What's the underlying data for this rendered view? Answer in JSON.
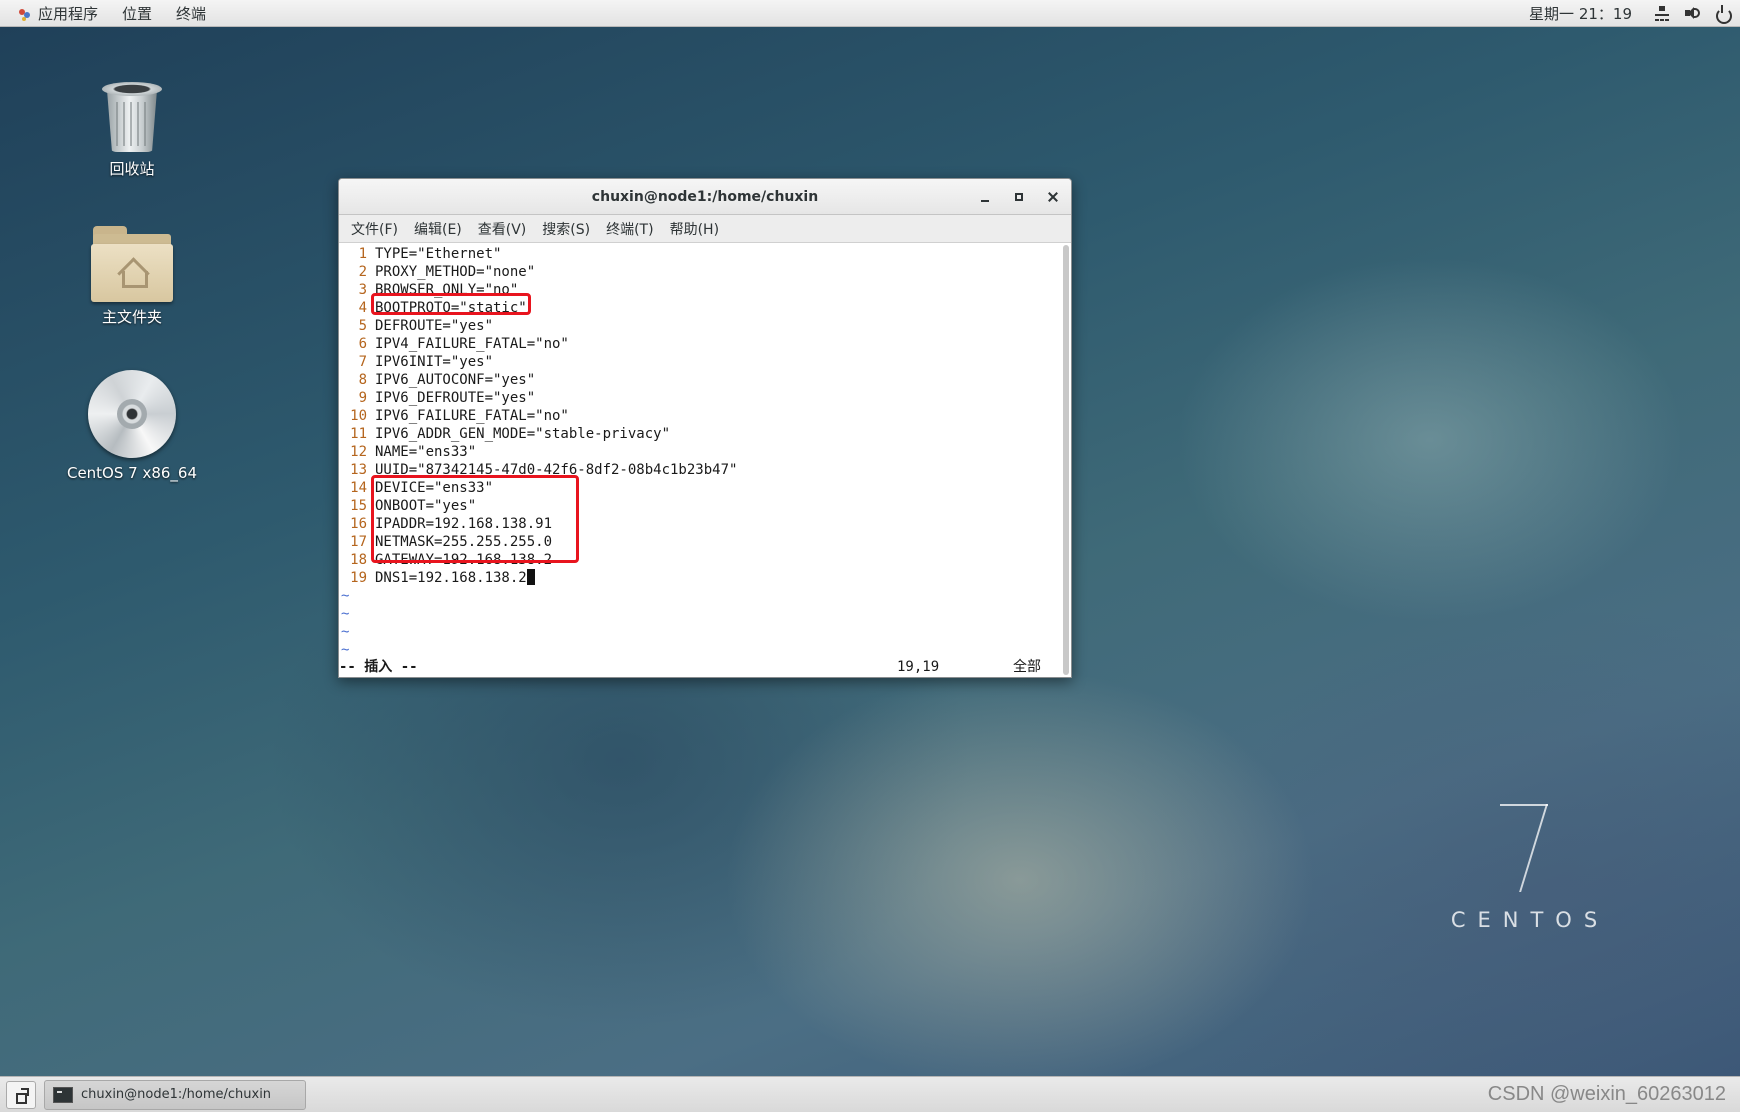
{
  "topbar": {
    "menu_applications": "应用程序",
    "menu_places": "位置",
    "menu_terminal": "终端",
    "clock": "星期一 21：19",
    "icons": [
      "network-icon",
      "volume-icon",
      "power-icon"
    ]
  },
  "desktop_icons": [
    {
      "label": "回收站",
      "icon": "trash-icon"
    },
    {
      "label": "主文件夹",
      "icon": "home-folder-icon"
    },
    {
      "label": "CentOS 7 x86_64",
      "icon": "cd-disc-icon"
    }
  ],
  "window": {
    "title": "chuxin@node1:/home/chuxin",
    "menu": [
      "文件(F)",
      "编辑(E)",
      "查看(V)",
      "搜索(S)",
      "终端(T)",
      "帮助(H)"
    ],
    "lines": [
      {
        "n": "1",
        "text": "TYPE=\"Ethernet\""
      },
      {
        "n": "2",
        "text": "PROXY_METHOD=\"none\""
      },
      {
        "n": "3",
        "text": "BROWSER_ONLY=\"no\""
      },
      {
        "n": "4",
        "text": "BOOTPROTO=\"static\""
      },
      {
        "n": "5",
        "text": "DEFROUTE=\"yes\""
      },
      {
        "n": "6",
        "text": "IPV4_FAILURE_FATAL=\"no\""
      },
      {
        "n": "7",
        "text": "IPV6INIT=\"yes\""
      },
      {
        "n": "8",
        "text": "IPV6_AUTOCONF=\"yes\""
      },
      {
        "n": "9",
        "text": "IPV6_DEFROUTE=\"yes\""
      },
      {
        "n": "10",
        "text": "IPV6_FAILURE_FATAL=\"no\""
      },
      {
        "n": "11",
        "text": "IPV6_ADDR_GEN_MODE=\"stable-privacy\""
      },
      {
        "n": "12",
        "text": "NAME=\"ens33\""
      },
      {
        "n": "13",
        "text": "UUID=\"87342145-47d0-42f6-8df2-08b4c1b23b47\""
      },
      {
        "n": "14",
        "text": "DEVICE=\"ens33\""
      },
      {
        "n": "15",
        "text": "ONBOOT=\"yes\""
      },
      {
        "n": "16",
        "text": "IPADDR=192.168.138.91"
      },
      {
        "n": "17",
        "text": "NETMASK=255.255.255.0"
      },
      {
        "n": "18",
        "text": "GATEWAY=192.168.138.2"
      },
      {
        "n": "19",
        "text": "DNS1=192.168.138.2"
      }
    ],
    "tilde": "~",
    "status_mode": "-- 插入 --",
    "status_position": "19,19",
    "status_scope": "全部"
  },
  "logo": {
    "seven": "7",
    "text": "CENTOS"
  },
  "taskbar": {
    "task_label": "chuxin@node1:/home/chuxin",
    "watermark": "CSDN @weixin_60263012"
  },
  "colors": {
    "highlight_box": "#e8141e",
    "line_number": "#b5651d",
    "tilde": "#4a6fd0"
  }
}
